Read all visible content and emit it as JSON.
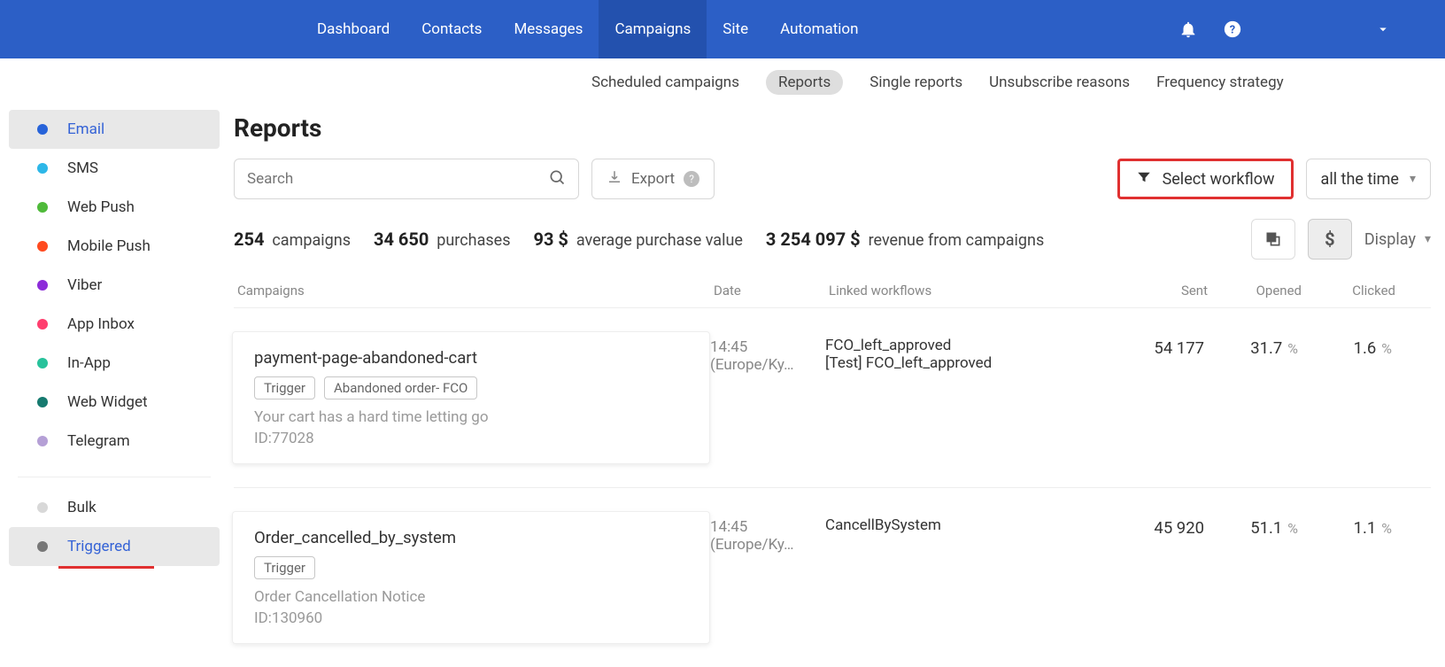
{
  "nav": {
    "items": [
      "Dashboard",
      "Contacts",
      "Messages",
      "Campaigns",
      "Site",
      "Automation"
    ],
    "activeIndex": 3
  },
  "subnav": {
    "items": [
      "Scheduled campaigns",
      "Reports",
      "Single reports",
      "Unsubscribe reasons",
      "Frequency strategy"
    ],
    "activeIndex": 1
  },
  "sidebar": {
    "channels": [
      {
        "label": "Email",
        "color": "email",
        "active": true
      },
      {
        "label": "SMS",
        "color": "sms"
      },
      {
        "label": "Web Push",
        "color": "webpush"
      },
      {
        "label": "Mobile Push",
        "color": "mobilepush"
      },
      {
        "label": "Viber",
        "color": "viber"
      },
      {
        "label": "App Inbox",
        "color": "appinbox"
      },
      {
        "label": "In-App",
        "color": "inapp"
      },
      {
        "label": "Web Widget",
        "color": "webwidget"
      },
      {
        "label": "Telegram",
        "color": "telegram"
      }
    ],
    "types": [
      {
        "label": "Bulk",
        "color": "bulk"
      },
      {
        "label": "Triggered",
        "color": "triggered",
        "active": true
      }
    ]
  },
  "page": {
    "title": "Reports"
  },
  "toolbar": {
    "search_placeholder": "Search",
    "export_label": "Export",
    "select_workflow_label": "Select workflow",
    "timerange_label": "all the time"
  },
  "stats": {
    "campaigns_count": "254",
    "campaigns_label": "campaigns",
    "purchases_count": "34 650",
    "purchases_label": "purchases",
    "avg_value": "93 $",
    "avg_label": "average purchase value",
    "revenue_value": "3 254 097 $",
    "revenue_label": "revenue from campaigns",
    "display_label": "Display"
  },
  "table": {
    "headers": {
      "campaigns": "Campaigns",
      "date": "Date",
      "linked": "Linked workflows",
      "sent": "Sent",
      "opened": "Opened",
      "clicked": "Clicked"
    },
    "rows": [
      {
        "name": "payment-page-abandoned-cart",
        "tags": [
          "Trigger",
          "Abandoned order- FCO"
        ],
        "subject": "Your cart has a hard time letting go",
        "id": "ID:77028",
        "time": "14:45",
        "tz": "(Europe/Ky…",
        "workflows": "FCO_left_approved\n[Test] FCO_left_approved",
        "sent": "54 177",
        "opened": "31.7",
        "clicked": "1.6"
      },
      {
        "name": "Order_cancelled_by_system",
        "tags": [
          "Trigger"
        ],
        "subject": "Order Cancellation Notice",
        "id": "ID:130960",
        "time": "14:45",
        "tz": "(Europe/Ky…",
        "workflows": "CancellBySystem",
        "sent": "45 920",
        "opened": "51.1",
        "clicked": "1.1"
      }
    ]
  }
}
